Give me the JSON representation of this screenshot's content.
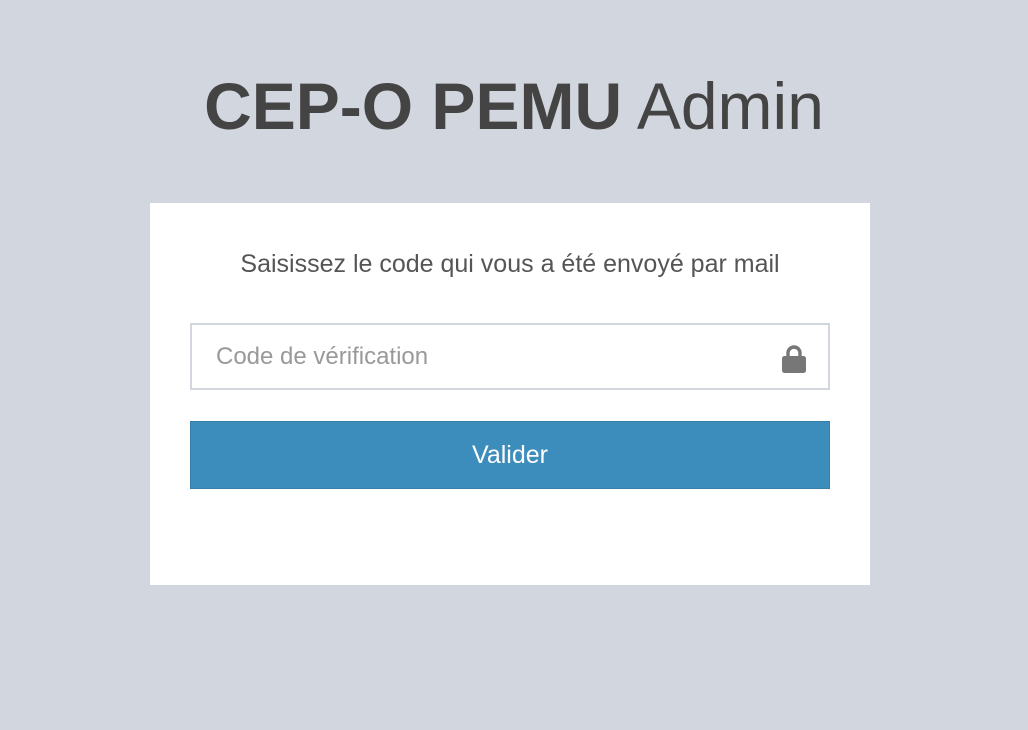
{
  "logo": {
    "bold": "CEP-O PEMU",
    "light": "Admin"
  },
  "login": {
    "message": "Saisissez le code qui vous a été envoyé par mail",
    "code_input": {
      "value": "",
      "placeholder": "Code de vérification",
      "icon": "lock-icon"
    },
    "submit_label": "Valider"
  },
  "colors": {
    "background": "#d2d6de",
    "panel": "#ffffff",
    "text": "#444444",
    "button": "#3c8dbc",
    "icon": "#777777"
  }
}
